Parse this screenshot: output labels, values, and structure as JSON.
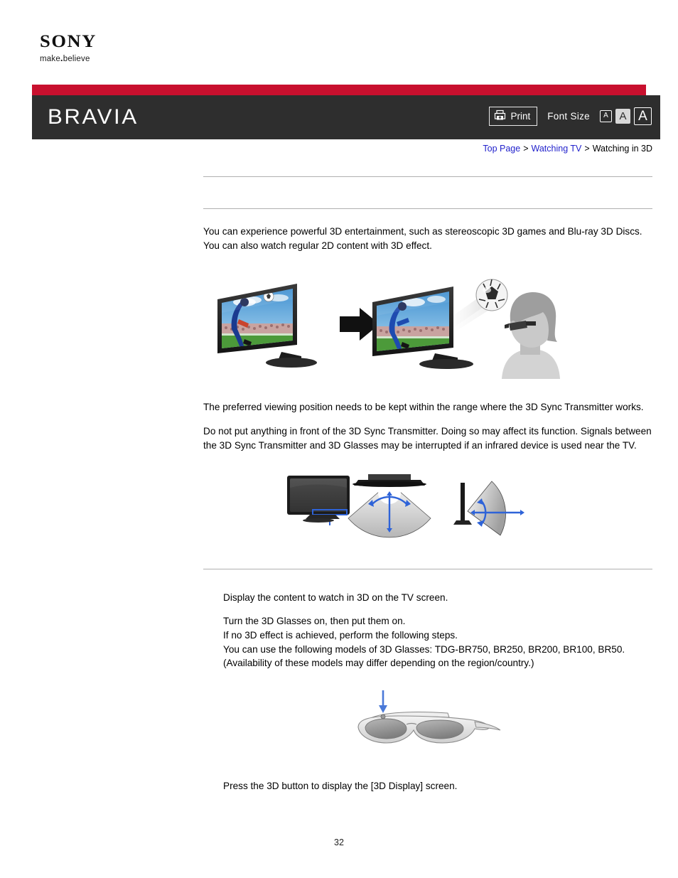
{
  "brand": {
    "logo_word": "SONY",
    "tagline_pre": "make",
    "tagline_dot": ".",
    "tagline_post": "believe",
    "product": "BRAVIA",
    "red": "#c8102e",
    "header_bg": "#2e2e2e"
  },
  "header": {
    "print_label": "Print",
    "print_icon": "printer-icon",
    "font_size_label": "Font Size",
    "font_size_options": [
      {
        "label": "A",
        "size": "small",
        "selected": false
      },
      {
        "label": "A",
        "size": "medium",
        "selected": true
      },
      {
        "label": "A",
        "size": "large",
        "selected": false
      }
    ]
  },
  "breadcrumb": {
    "items": [
      {
        "label": "Top Page",
        "link": true
      },
      {
        "label": "Watching TV",
        "link": true
      },
      {
        "label": "Watching in 3D",
        "link": false
      }
    ],
    "separator": ">"
  },
  "main": {
    "heading": "",
    "subheading": "",
    "intro": "You can experience powerful 3D entertainment, such as stereoscopic 3D games and Blu-ray 3D Discs. You can also watch regular 2D content with 3D effect.",
    "figure1": {
      "name": "2d-to-3d-illustration",
      "left_caption": "television showing soccer player",
      "arrow": "right-arrow-icon",
      "right_caption": "soccer ball coming out of television toward viewer wearing 3D glasses"
    },
    "note1": "The preferred viewing position needs to be kept within the range where the 3D Sync Transmitter works.",
    "note2": "Do not put anything in front of the 3D Sync Transmitter. Doing so may affect its function. Signals between the 3D Sync Transmitter and 3D Glasses may be interrupted if an infrared device is used near the TV.",
    "figure2": {
      "name": "sync-transmitter-range-illustration",
      "panel1_caption": "TV front view with 3D Sync Transmitter highlighted",
      "panel2_caption": "top view of transmitter coverage angle",
      "panel3_caption": "side view of transmitter coverage angle"
    },
    "steps": [
      "Display the content to watch in 3D on the TV screen.",
      "Turn the 3D Glasses on, then put them on.\nIf no 3D effect is achieved, perform the following steps.\nYou can use the following models of 3D Glasses: TDG-BR750, BR250, BR200, BR100, BR50. (Availability of these models may differ depending on the region/country.)"
    ],
    "figure3": {
      "name": "3d-glasses-power-button-illustration",
      "caption": "3D glasses with arrow pointing to power button"
    },
    "final_step": "Press the 3D button to display the [3D Display] screen."
  },
  "footer": {
    "page_number": "32"
  }
}
